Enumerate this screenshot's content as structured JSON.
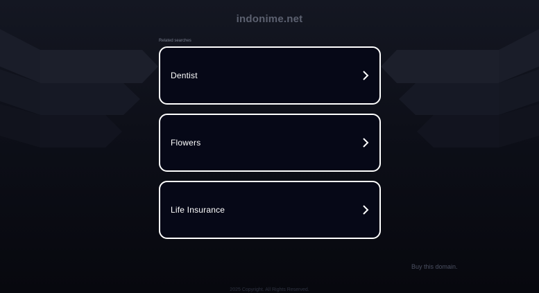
{
  "header": {
    "domain": "indonime.net"
  },
  "related": {
    "label": "Related searches",
    "items": [
      {
        "label": "Dentist"
      },
      {
        "label": "Flowers"
      },
      {
        "label": "Life Insurance"
      }
    ]
  },
  "actions": {
    "buy_domain": "Buy this domain."
  },
  "footer": {
    "text": "2025 Copyright. All Rights Reserved."
  },
  "colors": {
    "background": "#0a0c14",
    "card_background": "#060817",
    "card_border": "#ffffff",
    "title": "#5c6170"
  },
  "icons": {
    "card_arrow": "chevron-right-icon"
  }
}
